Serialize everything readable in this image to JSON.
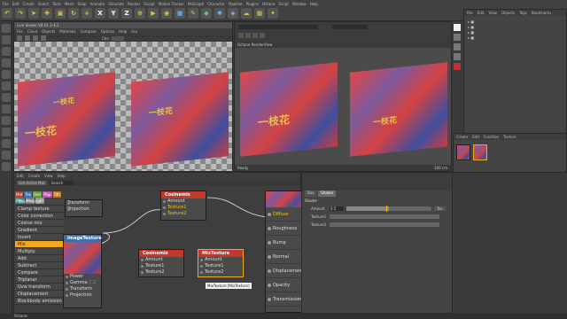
{
  "app": {
    "window_title": "Live Viewer V4.01 1-4.2",
    "status_text": "Instance"
  },
  "main_menu": [
    "File",
    "Edit",
    "Create",
    "Select",
    "Tools",
    "Mesh",
    "Snap",
    "Animate",
    "Simulate",
    "Render",
    "Sculpt",
    "Motion Tracker",
    "MoGraph",
    "Character",
    "Pipeline",
    "Plugins",
    "Octane",
    "Script",
    "Window",
    "Help"
  ],
  "toolbar_letters": [
    "X",
    "Y",
    "Z"
  ],
  "live_viewer": {
    "title": "Live Viewer V4.01 1-4.2",
    "menu": [
      "File",
      "Cloud",
      "Objects",
      "Materials",
      "Compare",
      "Options",
      "Help",
      "Gui"
    ],
    "chn_label": "Chn"
  },
  "render_view": {
    "title": "Octane RenderView",
    "footer_left": "Ready",
    "footer_right": "100 cm",
    "tex_text": "一枝花"
  },
  "object_manager": {
    "tabs": [
      "File",
      "Edit",
      "View",
      "Objects",
      "Tags",
      "Bookmarks"
    ]
  },
  "node_editor": {
    "menu": [
      "Edit",
      "Create",
      "View",
      "Help"
    ],
    "get_active_mat": "Get Active Mat",
    "search": "Search",
    "chips": [
      {
        "label": "Mat",
        "color": "#c0392b"
      },
      {
        "label": "Tex",
        "color": "#3d6fa8"
      },
      {
        "label": "Gen",
        "color": "#5c9c3c"
      },
      {
        "label": "Map",
        "color": "#b05ab0"
      },
      {
        "label": "Oth",
        "color": "#c07a2a"
      },
      {
        "label": "Ems",
        "color": "#2c8c8c"
      },
      {
        "label": "Med",
        "color": "#777777"
      },
      {
        "label": "C4D",
        "color": "#8a8a8a"
      }
    ],
    "categories": [
      "Toon ramp",
      "Clamp texture",
      "Color correction",
      "Cosine mix",
      "Gradient",
      "Invert",
      "Mix",
      "Multiply",
      "Add",
      "Subtract",
      "Compare",
      "Triplanar",
      "Uvw transform",
      "Displacement",
      "Blackbody emission"
    ],
    "selected_category": "Mix",
    "cosinemix_top": {
      "title": "Cosinemix",
      "ports": [
        "Amount",
        "Texture1",
        "Texture2"
      ]
    },
    "cosinemix_bottom": {
      "title": "Cosinemix",
      "ports": [
        "Amount",
        "Texture1",
        "Texture2"
      ]
    },
    "mixtexture": {
      "title": "MixTexture",
      "ports": [
        "Amount",
        "Texture1",
        "Texture2"
      ]
    },
    "imagetexture": {
      "title": "ImageTexture",
      "ports": [
        "Power",
        "Gamma",
        "Invert",
        "Transform",
        "Projection"
      ],
      "gamma_value": "2.2"
    },
    "transform_label": "Transform",
    "projection_label": "Projection",
    "material_ports": [
      "Diffuse",
      "Roughness",
      "Bump",
      "Normal",
      "Displacement",
      "Opacity",
      "Transmission"
    ],
    "tooltip": "MixTexture [MixTexture]"
  },
  "attributes": {
    "tabs": [
      "Bas",
      "Shader"
    ],
    "section": "Shader",
    "rows": [
      {
        "label": "Amount",
        "value": "0.5",
        "fill": 0.5
      },
      {
        "label": "Texture1",
        "value": ""
      },
      {
        "label": "Texture2",
        "value": ""
      }
    ],
    "edit_button": "Tex"
  },
  "material_manager": {
    "tabs": [
      "Create",
      "Edit",
      "Function",
      "Texture"
    ]
  },
  "statusbar": {
    "text": "Octane:"
  }
}
